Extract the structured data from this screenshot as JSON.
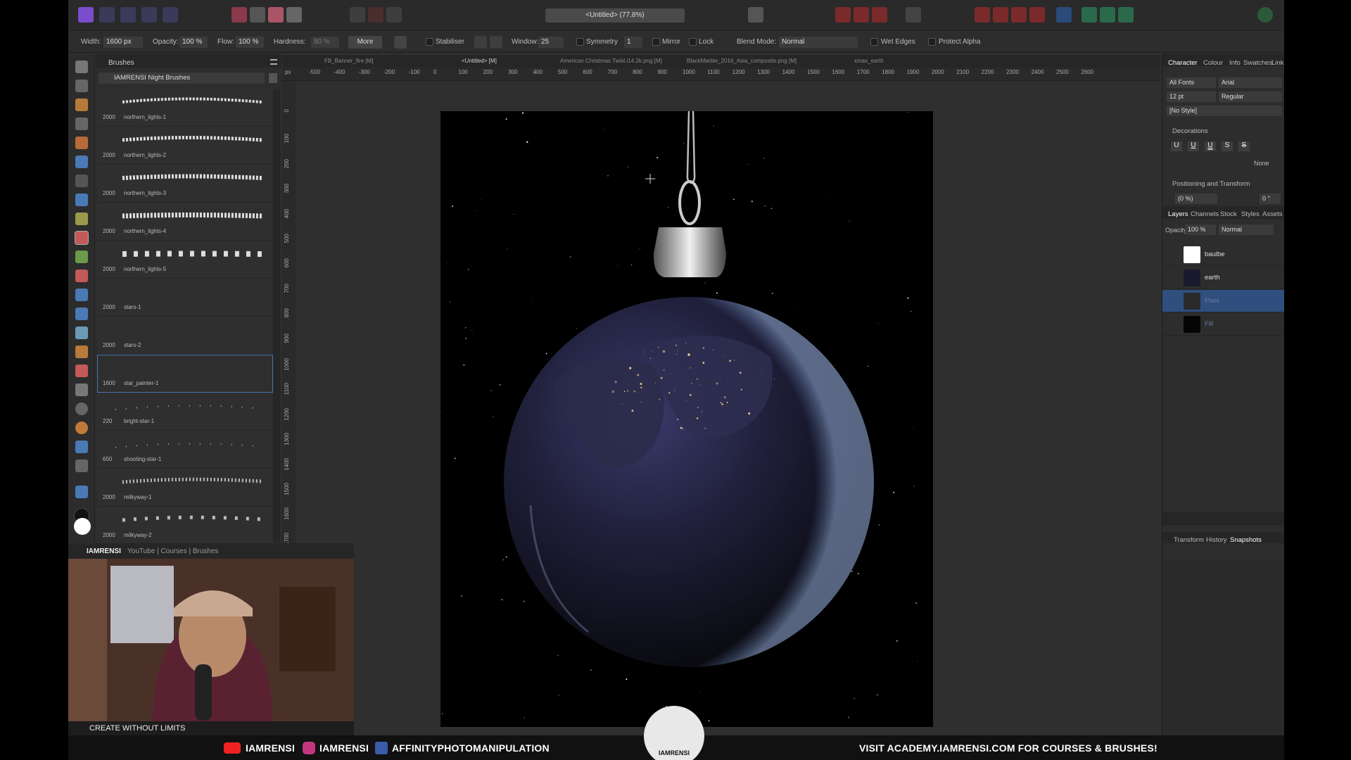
{
  "window": {
    "title": "<Untitled> (77.8%)"
  },
  "context_toolbar": {
    "width_label": "Width:",
    "width_value": "1600 px",
    "opacity_label": "Opacity:",
    "opacity_value": "100 %",
    "flow_label": "Flow:",
    "flow_value": "100 %",
    "hardness_label": "Hardness:",
    "hardness_value": "80 %",
    "more_label": "More",
    "stabiliser_label": "Stabiliser",
    "window_label": "Window:",
    "window_value": "25",
    "symmetry_label": "Symmetry",
    "symmetry_value": "1",
    "mirror_label": "Mirror",
    "lock_label": "Lock",
    "blend_label": "Blend Mode:",
    "blend_value": "Normal",
    "wet_edges_label": "Wet Edges",
    "protect_alpha_label": "Protect Alpha"
  },
  "brushes_panel": {
    "tab": "Brushes",
    "category": "IAMRENSI Night Brushes",
    "items": [
      {
        "size": "2000",
        "name": "northern_lights-1"
      },
      {
        "size": "2000",
        "name": "northern_lights-2"
      },
      {
        "size": "2000",
        "name": "northern_lights-3"
      },
      {
        "size": "2000",
        "name": "northern_lights-4"
      },
      {
        "size": "2000",
        "name": "northern_lights-5"
      },
      {
        "size": "2000",
        "name": "stars-1"
      },
      {
        "size": "2000",
        "name": "stars-2"
      },
      {
        "size": "1600",
        "name": "star_painter-1"
      },
      {
        "size": "220",
        "name": "bright-star-1"
      },
      {
        "size": "650",
        "name": "shooting-star-1"
      },
      {
        "size": "2000",
        "name": "milkyway-1"
      },
      {
        "size": "2000",
        "name": "milkyway-2"
      }
    ]
  },
  "document_tabs": [
    "FB_Banner_fire [M]",
    "<Untitled> [M]",
    "American Christmas Twist.i14.2k.png [M]",
    "BlackMarble_2016_Asia_composite.png [M]",
    "xmas_earth"
  ],
  "ruler_top": [
    "-500",
    "-400",
    "-300",
    "-200",
    "-100",
    "0",
    "100",
    "200",
    "300",
    "400",
    "500",
    "600",
    "700",
    "800",
    "900",
    "1000",
    "1100",
    "1200",
    "1300",
    "1400",
    "1500",
    "1600",
    "1700",
    "1800",
    "1900",
    "2000",
    "2100",
    "2200",
    "2300",
    "2400",
    "2500",
    "2600"
  ],
  "ruler_unit": "px",
  "ruler_left": [
    "0",
    "100",
    "200",
    "300",
    "400",
    "500",
    "600",
    "700",
    "800",
    "900",
    "1000",
    "1100",
    "1200",
    "1300",
    "1400",
    "1500",
    "1600",
    "1700"
  ],
  "character_panel": {
    "tabs": [
      "Character",
      "Colour",
      "Info",
      "Swatches",
      "Links"
    ],
    "font_collection": "All Fonts",
    "font_family": "Arial",
    "font_size": "12 pt",
    "font_style": "Regular",
    "style": "[No Style]",
    "decorations_label": "Decorations",
    "decoration_none": "None",
    "positioning_label": "Positioning and Transform",
    "tracking": "(0 %)",
    "rotation": "0 °"
  },
  "layers_panel": {
    "tabs": [
      "Layers",
      "Channels",
      "Stock",
      "Styles",
      "Assets"
    ],
    "opacity_label": "Opacity:",
    "opacity_value": "100 %",
    "blend_value": "Normal",
    "layers": [
      {
        "name": "baulbe",
        "selected": false
      },
      {
        "name": "earth",
        "selected": false
      },
      {
        "name": "Pixel",
        "selected": true
      },
      {
        "name": "Fill",
        "selected": false
      }
    ]
  },
  "history_panel": {
    "tabs": [
      "Transform",
      "History",
      "Snapshots"
    ]
  },
  "webcam": {
    "header_brand": "IAMRENSI",
    "header_links": "YouTube | Courses | Brushes",
    "footer": "CREATE WITHOUT LIMITS"
  },
  "social_bar": {
    "youtube": "IAMRENSI",
    "instagram": "IAMRENSI",
    "facebook": "AFFINITYPHOTOMANIPULATION",
    "academy": "VISIT ACADEMY.IAMRENSI.COM FOR COURSES & BRUSHES!",
    "logo_text": "IAMRENSI"
  },
  "colors": {
    "accent": "#4a73b5",
    "selected_layer": "#2f4f7f",
    "app_bg": "#303030"
  }
}
